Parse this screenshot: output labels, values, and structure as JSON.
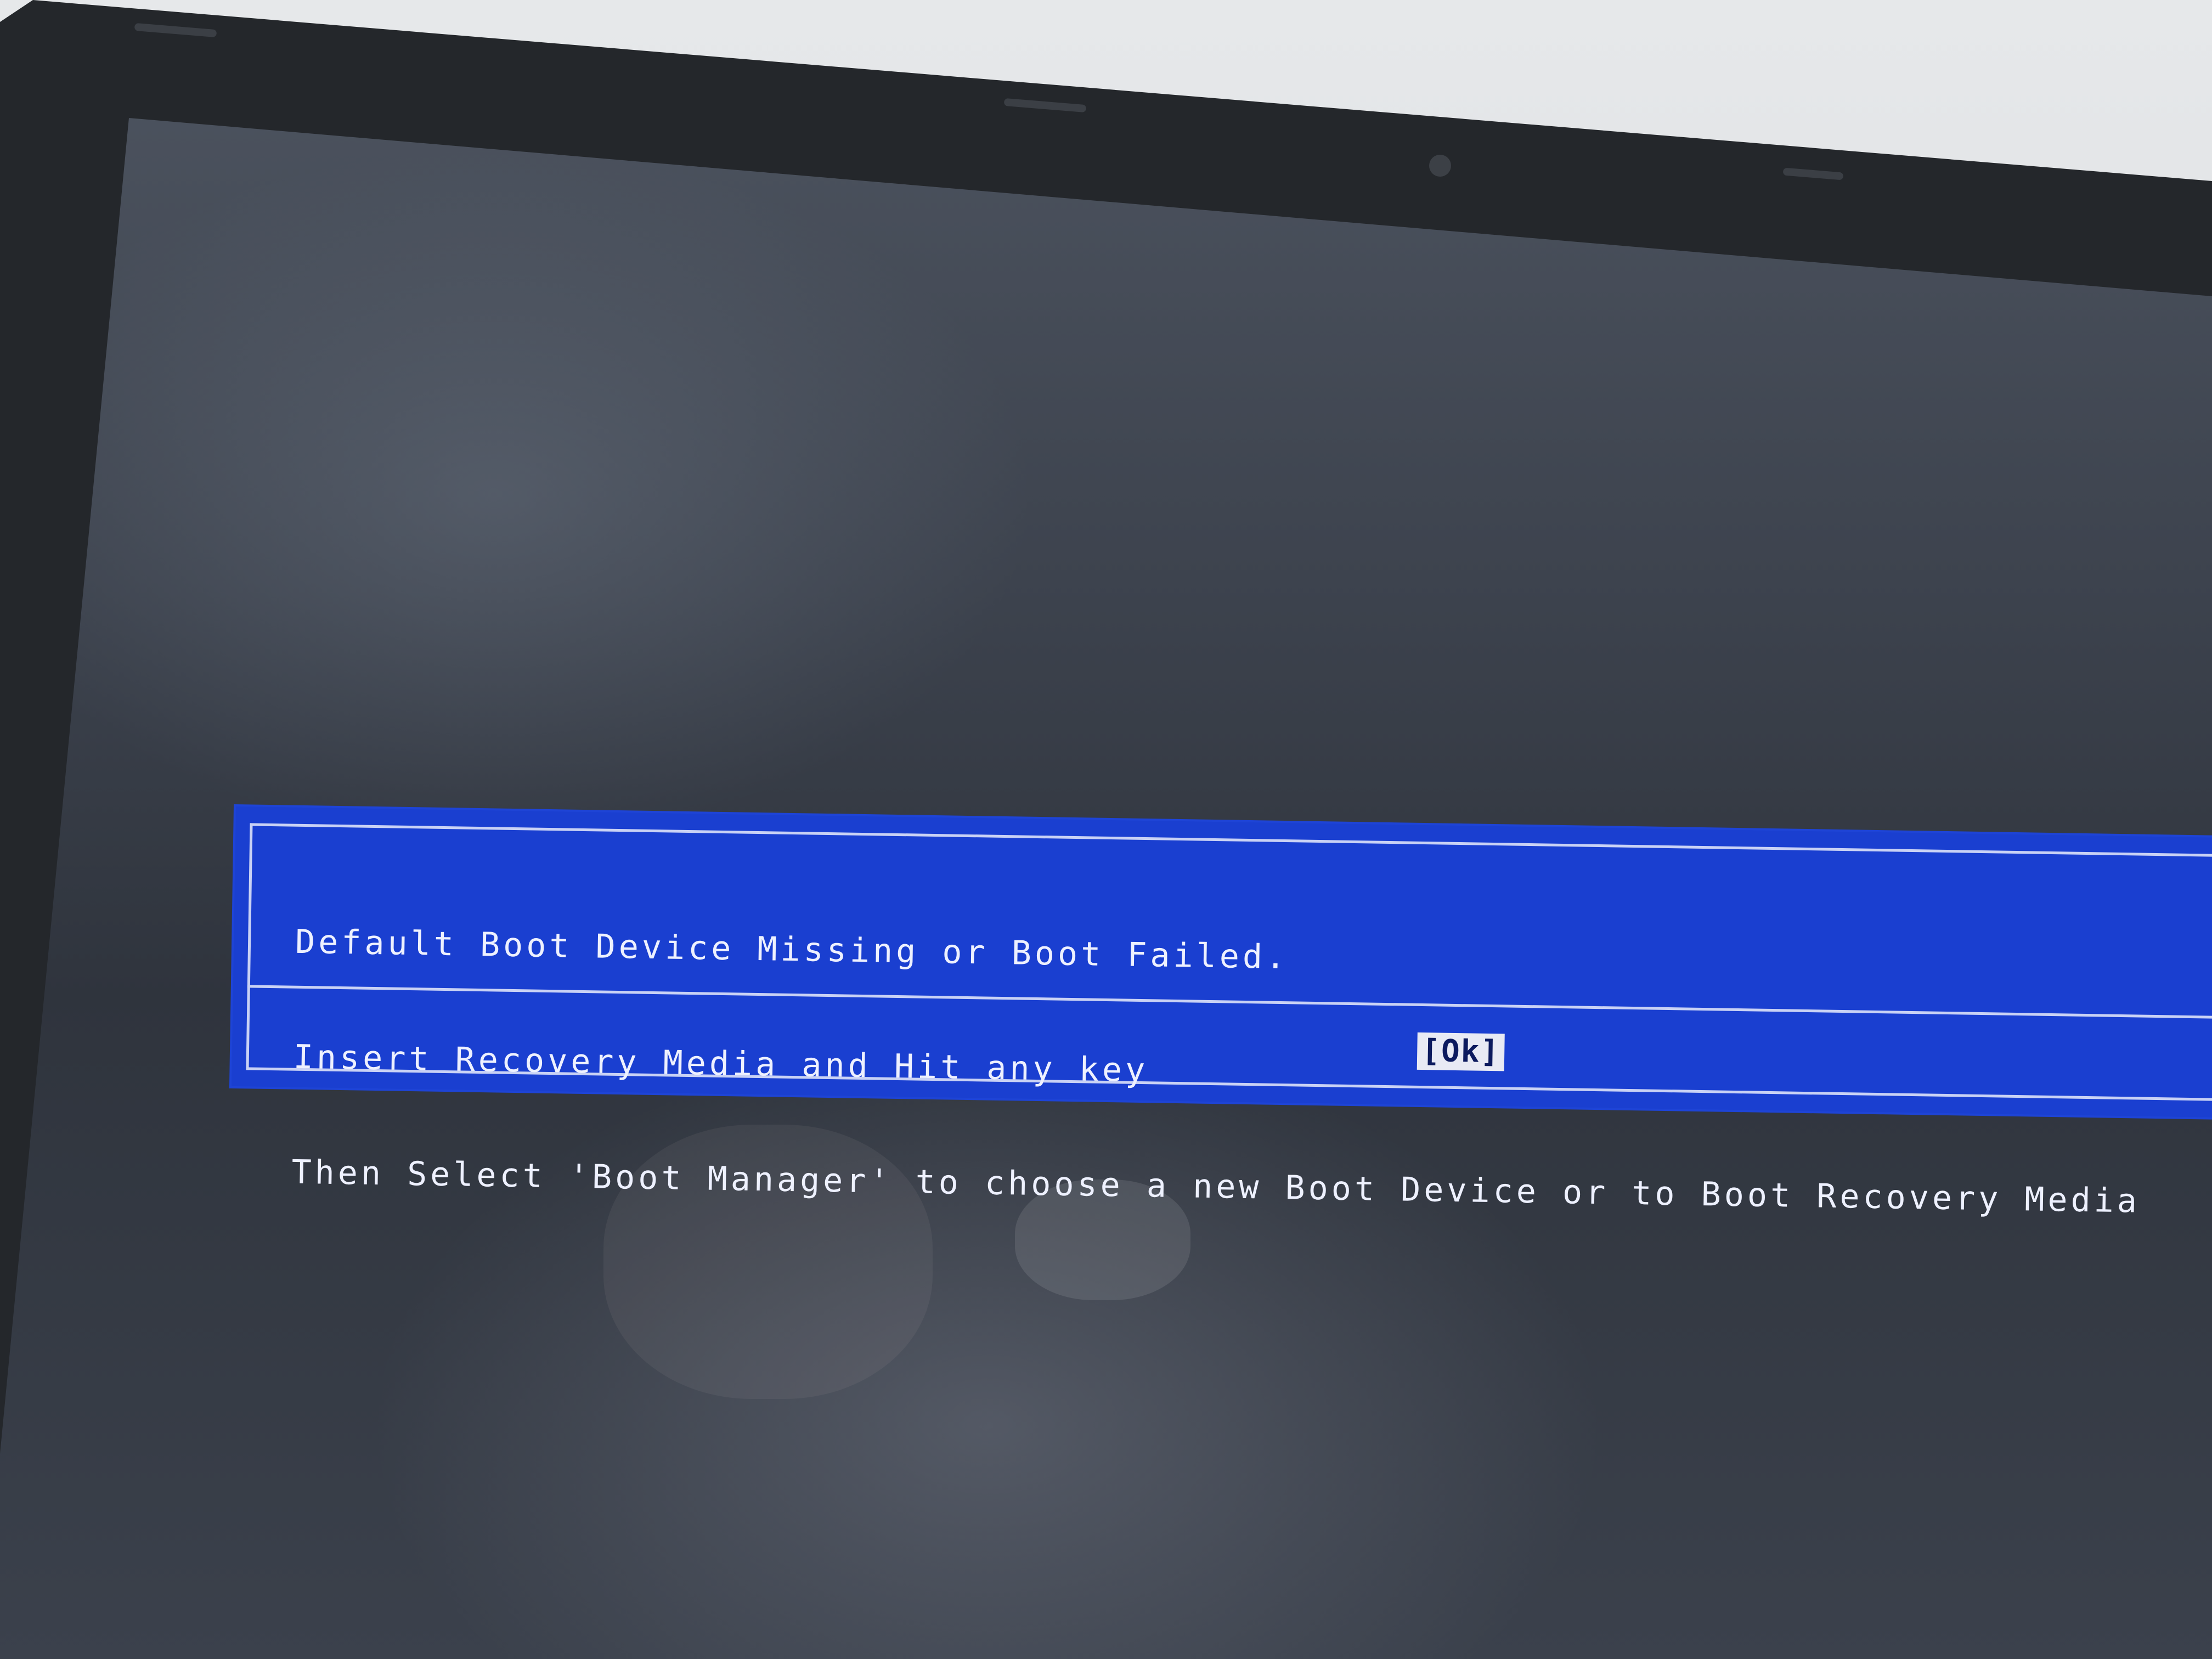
{
  "bios_dialog": {
    "message_lines": [
      "Default Boot Device Missing or Boot Failed.",
      "Insert Recovery Media and Hit any key",
      "Then Select 'Boot Manager' to choose a new Boot Device or to Boot Recovery Media"
    ],
    "ok_button_label": "[Ok]",
    "background_color": "#1a3fd0",
    "text_color": "#eef1ff"
  }
}
